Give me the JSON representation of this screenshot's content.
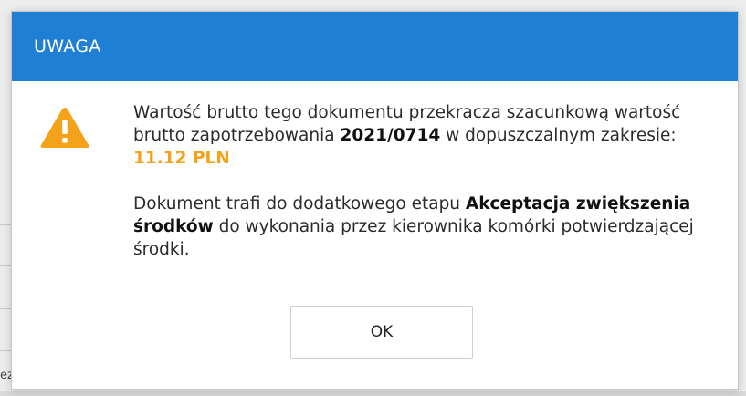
{
  "dialog": {
    "title": "UWAGA",
    "icon": "warning-triangle-icon",
    "accent_color": "#1f7fd4",
    "warning_color": "#f5a21b",
    "paragraph1": {
      "text_before": "Wartość brutto tego dokumentu przekracza szacunkową wartość brutto zapotrzebowania ",
      "document_number": "2021/0714",
      "text_middle": " w dopuszczalnym zakresie: ",
      "amount": "11.12 PLN"
    },
    "paragraph2": {
      "text_before": "Dokument trafi do dodatkowego etapu ",
      "stage_name": "Akceptacja zwiększenia środków",
      "text_after": " do wykonania przez kierownika komórki potwierdzającej środki."
    },
    "ok_label": "OK"
  },
  "background": {
    "partial_text": "ez"
  }
}
